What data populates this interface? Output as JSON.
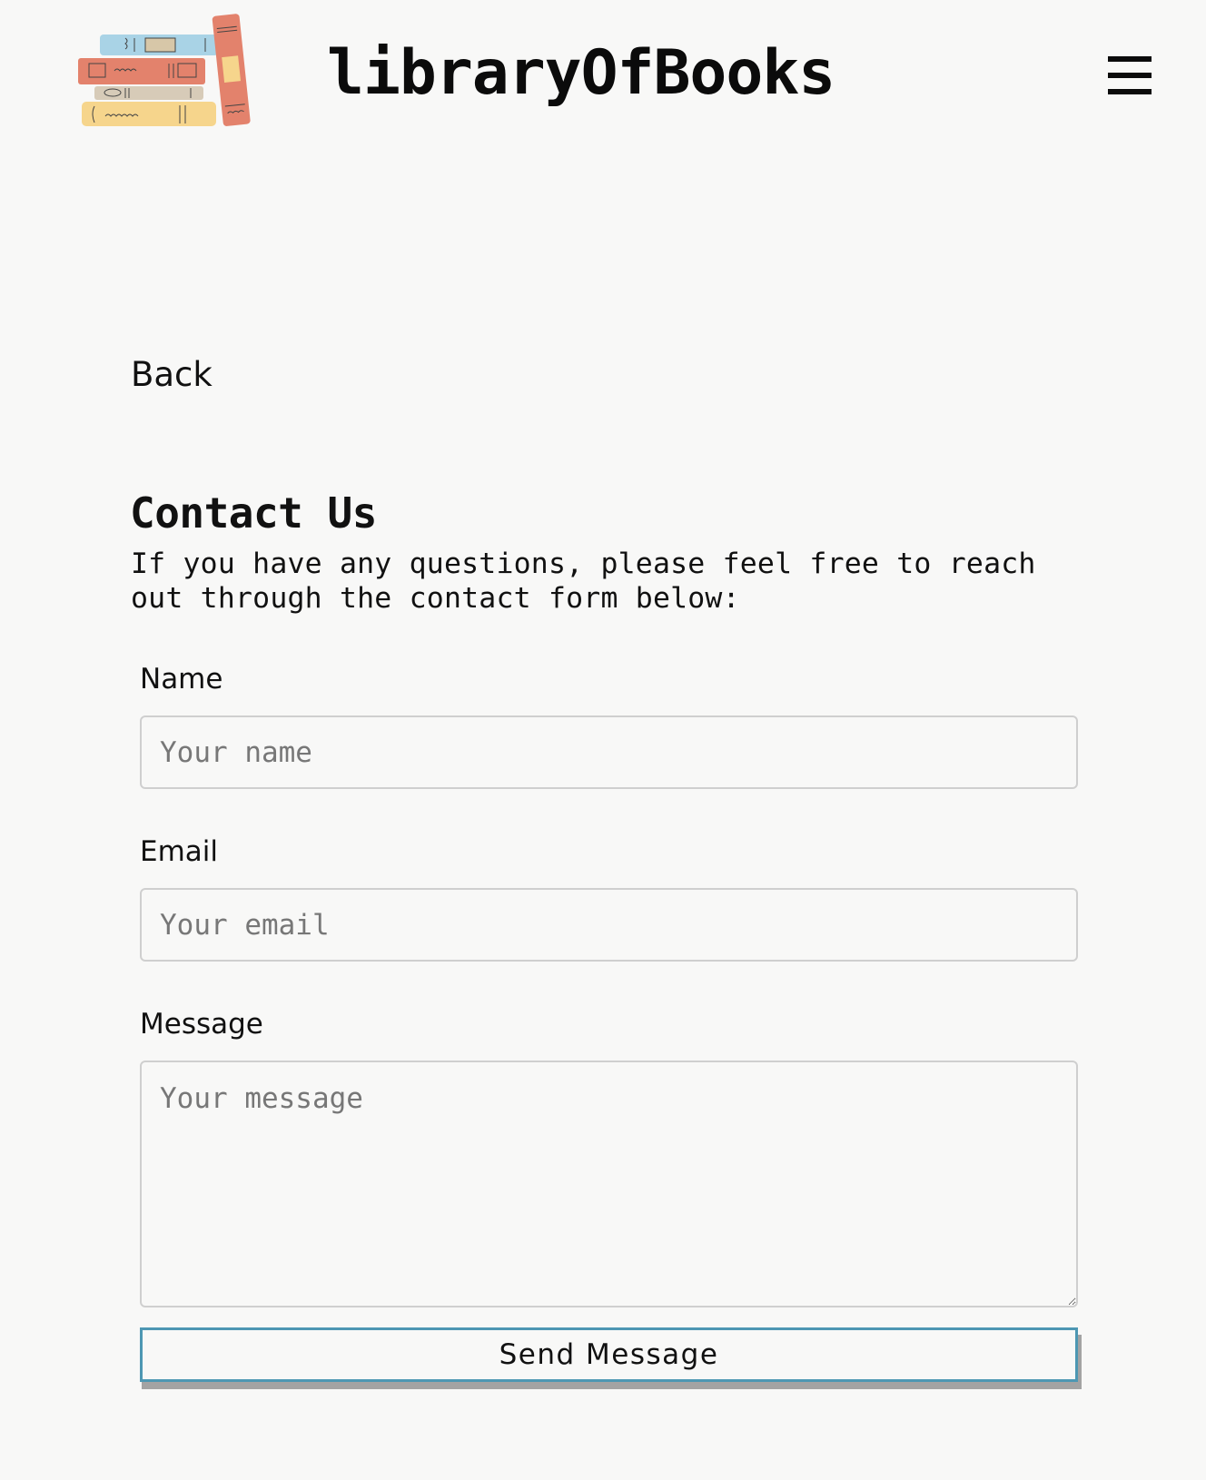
{
  "header": {
    "site_title": "libraryOfBooks",
    "logo_icon": "stacked-books-icon",
    "menu_icon": "hamburger-menu-icon",
    "colors": {
      "book_blue": "#a9d3e6",
      "book_red": "#e3826c",
      "book_beige": "#d7cbb8",
      "book_yellow": "#f6d58c"
    }
  },
  "nav": {
    "back_label": "Back"
  },
  "contact": {
    "heading": "Contact Us",
    "intro": "If you have any questions, please feel free to reach out through the contact form below:",
    "name_label": "Name",
    "name_placeholder": "Your name",
    "email_label": "Email",
    "email_placeholder": "Your email",
    "message_label": "Message",
    "message_placeholder": "Your message",
    "submit_label": "Send Message",
    "accent_color": "#4d97b3"
  }
}
